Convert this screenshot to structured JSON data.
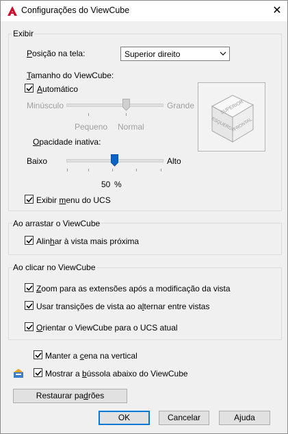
{
  "window": {
    "title": "Configurações do ViewCube",
    "close_glyph": "✕"
  },
  "display": {
    "legend": "Exibir",
    "position_label": "Posição na tela:",
    "position_value": "Superior direito",
    "size_label": "Tamanho do ViewCube:",
    "auto_label": "Automático",
    "auto_checked": true,
    "size_min_label": "Minúsculo",
    "size_max_label": "Grande",
    "size_tick_small": "Pequeno",
    "size_tick_normal": "Normal",
    "size_value_level": "Normal",
    "opacity_label": "Opacidade inativa:",
    "opacity_min_label": "Baixo",
    "opacity_max_label": "Alto",
    "opacity_percent": 50,
    "opacity_value": "50",
    "opacity_unit": "%",
    "show_ucs_menu_label": "Exibir menu do UCS",
    "show_ucs_menu_checked": true,
    "cube_faces": {
      "top": "SUPERIOR",
      "left": "ESQUERDA",
      "right": "FRONTAL"
    }
  },
  "drag": {
    "legend": "Ao arrastar o ViewCube",
    "snap_label": "Alinhar à vista mais próxima",
    "snap_checked": true
  },
  "click": {
    "legend": "Ao clicar no ViewCube",
    "zoom_label": "Zoom para as extensões após a modificação da vista",
    "zoom_checked": true,
    "transitions_label": "Usar transições de vista ao alternar entre vistas",
    "transitions_checked": true,
    "orient_label": "Orientar o ViewCube para o UCS atual",
    "orient_checked": true
  },
  "misc": {
    "upright_label": "Manter a cena na vertical",
    "upright_checked": true,
    "compass_label": "Mostrar a bússola abaixo do ViewCube",
    "compass_checked": true
  },
  "buttons": {
    "restore": "Restaurar padrões",
    "ok": "OK",
    "cancel": "Cancelar",
    "help": "Ajuda"
  },
  "colors": {
    "accent": "#0078d7",
    "thumb": "#0a64c8",
    "disabled_text": "#a0a0a0",
    "app_logo": "#c8102e"
  }
}
